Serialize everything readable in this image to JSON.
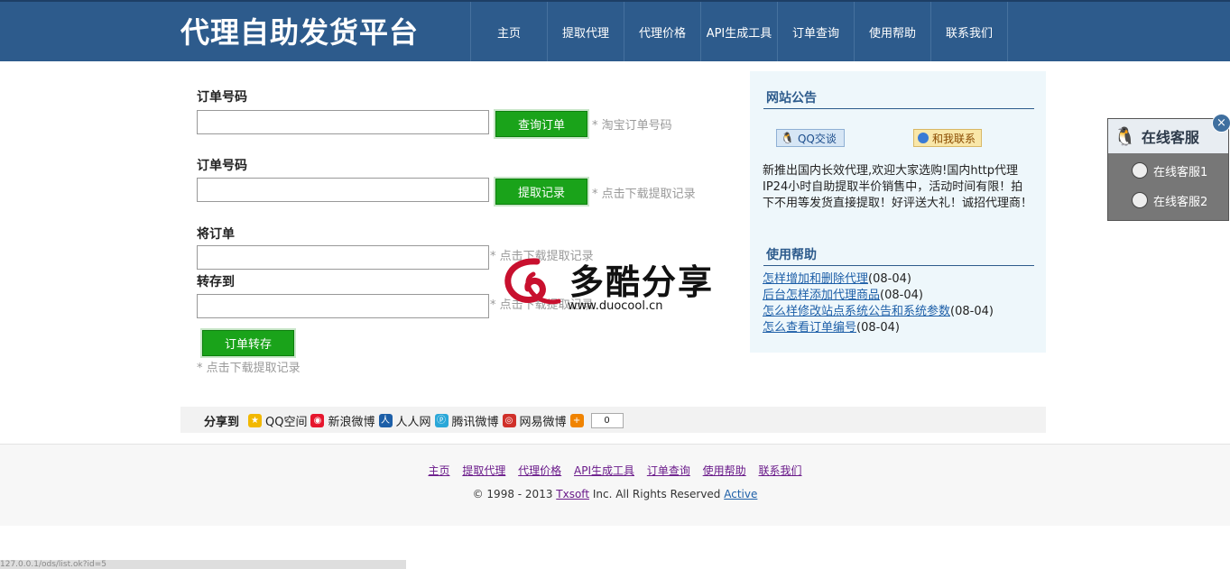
{
  "header": {
    "title": "代理自助发货平台",
    "nav": [
      "主页",
      "提取代理",
      "代理价格",
      "API生成工具",
      "订单查询",
      "使用帮助",
      "联系我们"
    ]
  },
  "form": {
    "order_label_1": "订单号码",
    "query_button": "查询订单",
    "query_hint": "* 淘宝订单号码",
    "order_label_2": "订单号码",
    "extract_button": "提取记录",
    "extract_hint": "* 点击下载提取记录",
    "transfer_from_label": "将订单",
    "transfer_from_hint": "* 点击下载提取记录",
    "transfer_to_label": "转存到",
    "transfer_to_hint": "* 点击下载提取记录",
    "transfer_button": "订单转存",
    "transfer_hint": "* 点击下载提取记录"
  },
  "sidebar": {
    "notice_title": "网站公告",
    "qq_chat": "QQ交谈",
    "contact_me": "和我联系",
    "notice_text": "新推出国内长效代理,欢迎大家选购!国内http代理IP24小时自助提取半价销售中，活动时间有限！拍下不用等发货直接提取！好评送大礼！诚招代理商！",
    "help_title": "使用帮助",
    "help_items": [
      {
        "title": "怎样增加和删除代理",
        "date": "(08-04)"
      },
      {
        "title": "后台怎样添加代理商品",
        "date": "(08-04)"
      },
      {
        "title": "怎么样修改站点系统公告和系统参数",
        "date": "(08-04)"
      },
      {
        "title": "怎么查看订单编号",
        "date": "(08-04)"
      }
    ]
  },
  "share": {
    "label": "分享到",
    "items": [
      "QQ空间",
      "新浪微博",
      "人人网",
      "腾讯微博",
      "网易微博"
    ],
    "count": "0"
  },
  "footer": {
    "links": [
      "主页",
      "提取代理",
      "代理价格",
      "API生成工具",
      "订单查询",
      "使用帮助",
      "联系我们"
    ],
    "copyright_pre": "© 1998 - 2013 ",
    "company": "Txsoft",
    "copyright_mid": " Inc. All Rights Reserved ",
    "active": "Active"
  },
  "service": {
    "title": "在线客服",
    "items": [
      "在线客服1",
      "在线客服2"
    ],
    "close": "×"
  },
  "watermark": {
    "text": "多酷分享",
    "url": "www.duocool.cn"
  },
  "status_bar": "127.0.0.1/ods/list.ok?id=5"
}
